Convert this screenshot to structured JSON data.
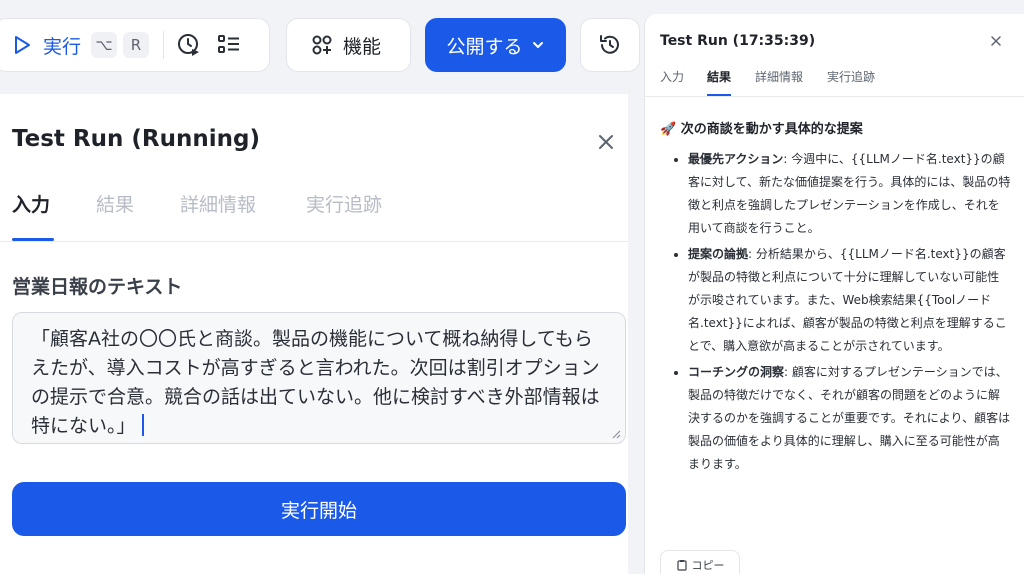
{
  "toolbar": {
    "run_label": "実行",
    "shortcut_option": "⌥",
    "shortcut_key": "R",
    "feature_label": "機能",
    "publish_label": "公開する"
  },
  "left_panel": {
    "title": "Test Run (Running)",
    "tabs": [
      "入力",
      "結果",
      "詳細情報",
      "実行追跡"
    ],
    "field_label": "営業日報のテキスト",
    "field_value": "「顧客A社の〇〇氏と商談。製品の機能について概ね納得してもらえたが、導入コストが高すぎると言われた。次回は割引オプションの提示で合意。競合の話は出ていない。他に検討すべき外部情報は特にない。」",
    "start_button": "実行開始"
  },
  "right_panel": {
    "title": "Test Run (17:35:39)",
    "tabs": [
      "入力",
      "結果",
      "詳細情報",
      "実行追跡"
    ],
    "heading_emoji": "🚀",
    "heading": "次の商談を動かす具体的な提案",
    "items": [
      {
        "label": "最優先アクション",
        "text": ": 今週中に、{{LLMノード名.text}}の顧客に対して、新たな価値提案を行う。具体的には、製品の特徴と利点を強調したプレゼンテーションを作成し、それを用いて商談を行うこと。"
      },
      {
        "label": "提案の論拠",
        "text": ": 分析結果から、{{LLMノード名.text}}の顧客が製品の特徴と利点について十分に理解していない可能性が示唆されています。また、Web検索結果{{Toolノード名.text}}によれば、顧客が製品の特徴と利点を理解することで、購入意欲が高まることが示されています。"
      },
      {
        "label": "コーチングの洞察",
        "text": ": 顧客に対するプレゼンテーションでは、製品の特徴だけでなく、それが顧客の問題をどのように解決するのかを強調することが重要です。それにより、顧客は製品の価値をより具体的に理解し、購入に至る可能性が高まります。"
      }
    ],
    "copy_button": "コピー"
  },
  "colors": {
    "primary": "#1b5ae8",
    "background": "#f2f3f6",
    "text": "#1f2329",
    "muted": "#b7bcc6"
  }
}
